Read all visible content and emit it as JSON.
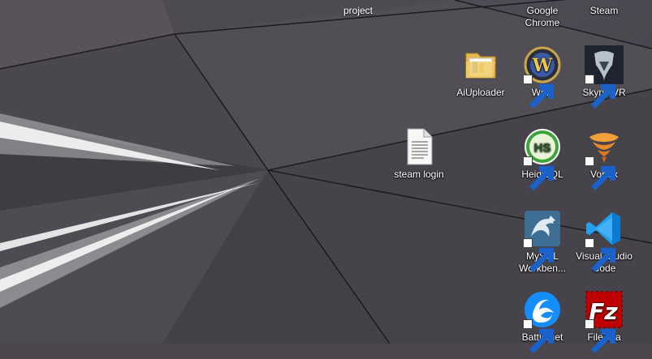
{
  "desktop": {
    "icons": [
      {
        "label": "project"
      },
      {
        "label": "Google\nChrome"
      },
      {
        "label": "Steam"
      },
      {
        "label": "AiUploader"
      },
      {
        "label": "Wow"
      },
      {
        "label": "SkyrimVR"
      },
      {
        "label": "steam login"
      },
      {
        "label": "HeidiSQL",
        "glyph_text": "HS"
      },
      {
        "label": "Vortex"
      },
      {
        "label": "MySQL\nWorkben..."
      },
      {
        "label": "Visual Studio\nCode"
      },
      {
        "label": "Battle.net"
      },
      {
        "label": "FileZilla"
      }
    ]
  },
  "colors": {
    "wallpaper_base": "#4b474d",
    "heidisql_green": "#3fa33b",
    "vscode_blue": "#23a0f0",
    "battlenet_blue": "#148eff",
    "filezilla_red": "#bf0000",
    "mysql_blue": "#3e6e93"
  }
}
